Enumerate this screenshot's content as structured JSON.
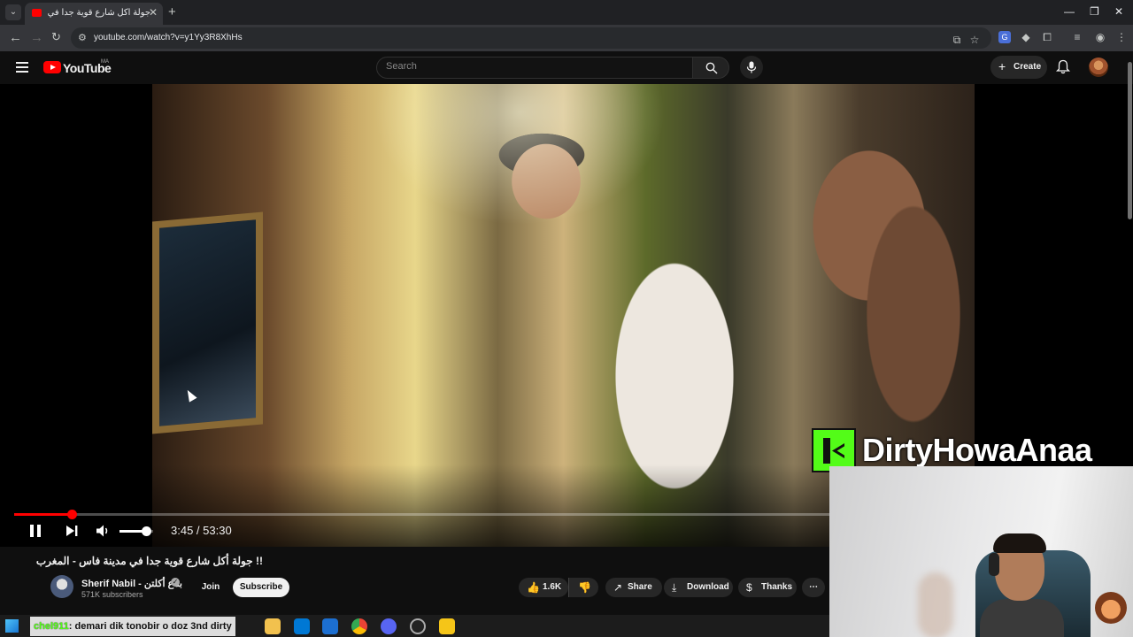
{
  "browser": {
    "tab_title": "جولة أكل شارع قوية جدا في ...",
    "tab_audio_icon": "speaker-icon",
    "url": "youtube.com/watch?v=y1Yy3R8XhHs"
  },
  "youtube": {
    "wordmark": "YouTube",
    "region": "MA",
    "search_placeholder": "Search",
    "create_label": "Create"
  },
  "player": {
    "current_time": "3:45",
    "duration": "53:30",
    "time_display": "3:45 / 53:30",
    "progress_fraction": 0.0701,
    "volume_fraction": 0.8,
    "state": "playing"
  },
  "overlay": {
    "stream_name": "DirtyHowaAnaa",
    "platform_icon": "kick-logo-icon",
    "accent_color": "#53fc18"
  },
  "video": {
    "title": "!! جولة أكل شارع قوية جدا في مدينة فاس - المغرب",
    "channel_name": "Sherif Nabil - بتاع أكلتن",
    "subscribers": "571K subscribers",
    "join_label": "Join",
    "subscribe_label": "Subscribe",
    "likes": "1.6K",
    "share_label": "Share",
    "download_label": "Download",
    "thanks_label": "Thanks"
  },
  "chat": {
    "username": "chel911",
    "message": ": demari dik tonobir o doz 3nd dirty"
  },
  "colors": {
    "youtube_red": "#ff0000",
    "background": "#0f0f0f"
  }
}
